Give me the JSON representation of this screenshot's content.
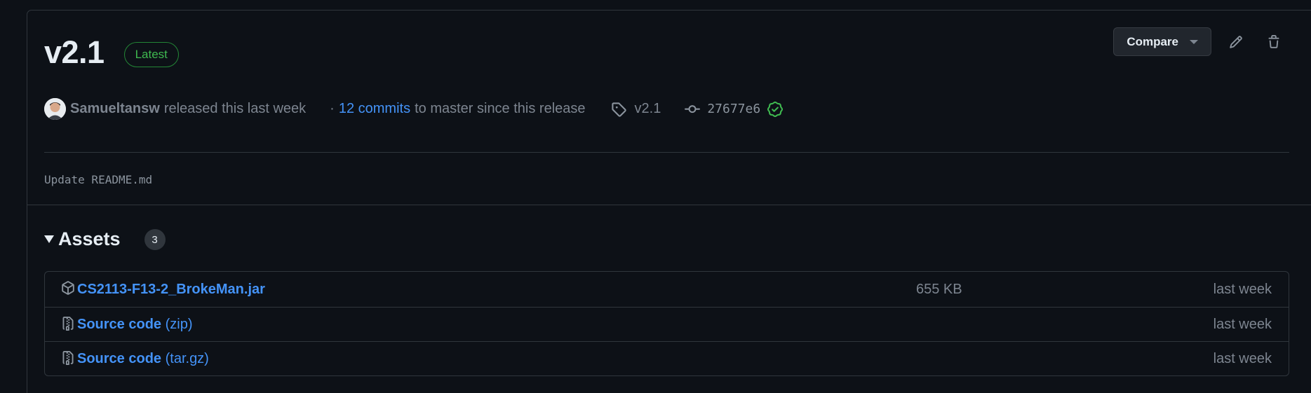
{
  "release": {
    "title": "v2.1",
    "latest_badge": "Latest",
    "compare_label": "Compare",
    "author": "Samueltansw",
    "released_text": "released this last week",
    "separator": "·",
    "commits_link": "12 commits",
    "commits_suffix": "to master since this release",
    "tag": "v2.1",
    "commit_hash": "27677e6",
    "body": "Update README.md"
  },
  "assets": {
    "title": "Assets",
    "count": "3",
    "items": [
      {
        "name": "CS2113-F13-2_BrokeMan.jar",
        "name_suffix": "",
        "size": "655 KB",
        "date": "last week",
        "icon": "package-icon"
      },
      {
        "name": "Source code",
        "name_suffix": "(zip)",
        "size": "",
        "date": "last week",
        "icon": "file-zip-icon"
      },
      {
        "name": "Source code",
        "name_suffix": "(tar.gz)",
        "size": "",
        "date": "last week",
        "icon": "file-zip-icon"
      }
    ]
  },
  "colors": {
    "background": "#0d1117",
    "border": "#30363d",
    "link": "#4493f8",
    "success": "#3fb950",
    "muted": "#7d8590"
  }
}
